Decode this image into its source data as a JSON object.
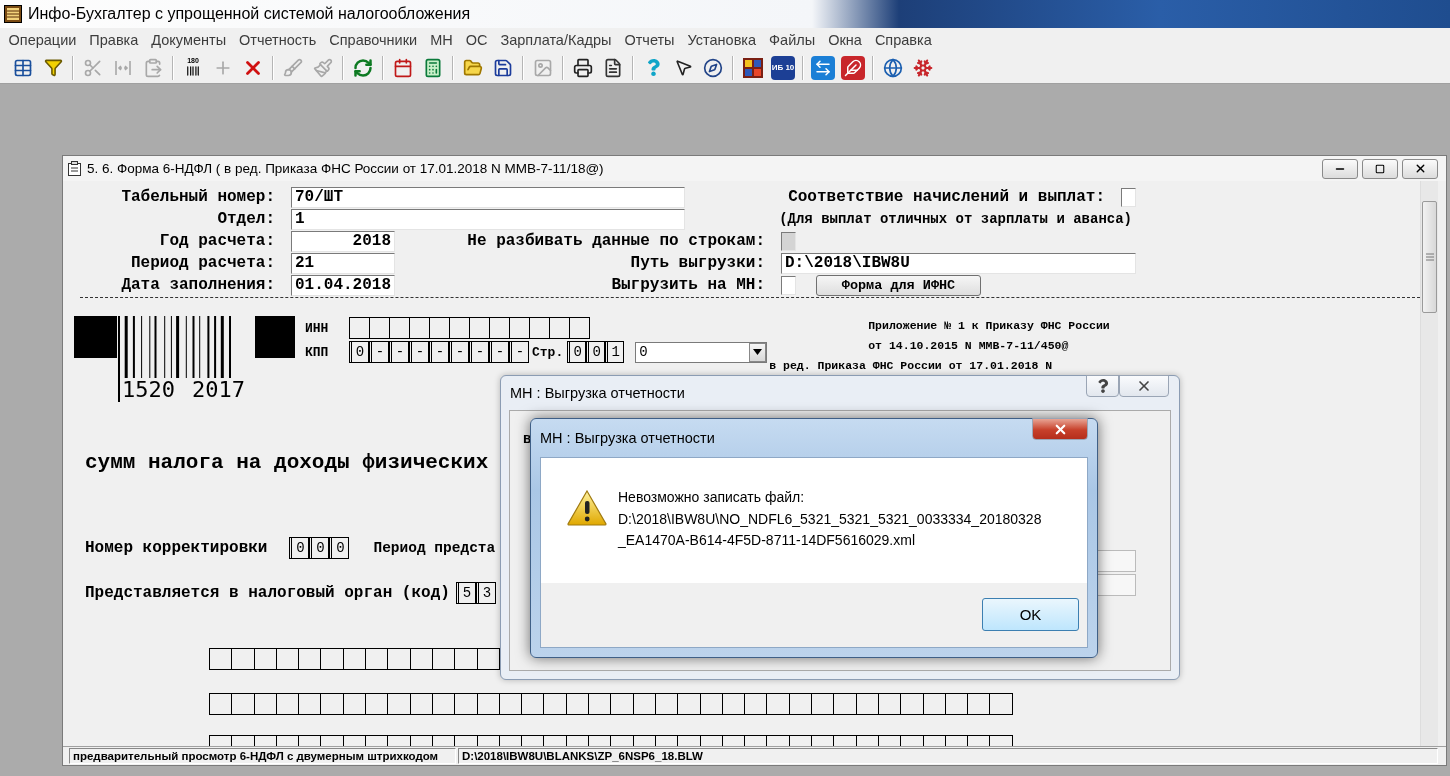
{
  "window": {
    "title": "Инфо-Бухгалтер с упрощенной системой налогообложения"
  },
  "menu": [
    "Операции",
    "Правка",
    "Документы",
    "Отчетность",
    "Справочники",
    "МН",
    "ОС",
    "Зарплата/Кадры",
    "Отчеты",
    "Установка",
    "Файлы",
    "Окна",
    "Справка"
  ],
  "toolbar": [
    [
      {
        "disabled": false
      },
      {
        "disabled": false
      }
    ],
    [
      {
        "disabled": true
      },
      {
        "disabled": true
      },
      {
        "disabled": true
      }
    ],
    [
      {
        "disabled": false,
        "text": "180"
      },
      {
        "disabled": true
      },
      {
        "disabled": false
      }
    ],
    [
      {
        "disabled": true
      },
      {
        "disabled": true
      }
    ],
    [
      {
        "disabled": false
      }
    ],
    [
      {
        "disabled": false
      },
      {
        "disabled": false
      }
    ],
    [
      {
        "disabled": false
      },
      {
        "disabled": false
      }
    ],
    [
      {
        "disabled": true
      }
    ],
    [
      {
        "disabled": false
      },
      {
        "disabled": false
      }
    ],
    [
      {
        "disabled": false
      },
      {
        "disabled": false
      },
      {
        "disabled": false
      }
    ],
    [
      {
        "disabled": false
      },
      {
        "disabled": false,
        "text": "ИБ 10"
      }
    ],
    [
      {
        "disabled": false
      },
      {
        "disabled": false
      }
    ],
    [
      {
        "disabled": false
      },
      {
        "disabled": false
      }
    ]
  ],
  "document": {
    "title": "5. 6. Форма 6-НДФЛ ( в ред. Приказа ФНС России от 17.01.2018 N ММВ-7-11/18@)"
  },
  "form": {
    "tab_number": {
      "label": "Табельный номер:",
      "value": "70/ШТ"
    },
    "match_payments": {
      "label": "Соответствие начислений и выплат:",
      "checked": false
    },
    "department": {
      "label": "Отдел:",
      "value": "1"
    },
    "match_note": "(Для выплат отличных от зарплаты и аванса)",
    "year": {
      "label": "Год расчета:",
      "value": "2018"
    },
    "no_split": {
      "label": "Не разбивать данные по строкам:",
      "checked": false,
      "disabled": true
    },
    "period": {
      "label": "Период расчета:",
      "value": "21"
    },
    "export_path": {
      "label": "Путь выгрузки:",
      "value": "D:\\2018\\IBW8U"
    },
    "fill_date": {
      "label": "Дата заполнения:",
      "value": "01.04.2018"
    },
    "export_mn": {
      "label": "Выгрузить на МН:",
      "checked": false
    },
    "ifns_button": "Форма для ИФНС"
  },
  "blank": {
    "barcode_digits": [
      "1520",
      "2017"
    ],
    "inn": {
      "label": "ИНН"
    },
    "kpp": {
      "label": "КПП",
      "cells": [
        "0",
        "-",
        "-",
        "-",
        "-",
        "-",
        "-",
        "-",
        "-"
      ]
    },
    "page": {
      "label": "Стр.",
      "cells": [
        "0",
        "0",
        "1"
      ]
    },
    "page_select": {
      "value": "0"
    },
    "notes": [
      "Приложение № 1 к Приказу ФНС России",
      "от 14.10.2015 N ММВ-7-11/450@",
      "в ред. Приказа ФНС России от 17.01.2018 N"
    ],
    "heading": "сумм налога на доходы физических",
    "correction": {
      "label": "Номер корректировки",
      "cells": [
        "0",
        "0",
        "0"
      ]
    },
    "period_label": "Период предста",
    "tax_office": {
      "label": "Представляется в налоговый орган (код)",
      "cells": [
        "5",
        "3"
      ]
    }
  },
  "status_bar": [
    "предварительный просмотр 6-НДФЛ с двумерным штрихкодом",
    "D:\\2018\\IBW8U\\BLANKS\\ZP_6NSP6_18.BLW"
  ],
  "export_dialog": {
    "title": "МН : Выгрузка отчетности",
    "label": "в"
  },
  "error_dialog": {
    "title": "МН : Выгрузка отчетности",
    "message": "Невозможно записать файл:",
    "path_lines": [
      "D:\\2018\\IBW8U\\NO_NDFL6_5321_5321_5321_0033334_20180328",
      "_EA1470A-B614-4F5D-8711-14DF5616029.xml"
    ],
    "button": "OK"
  }
}
